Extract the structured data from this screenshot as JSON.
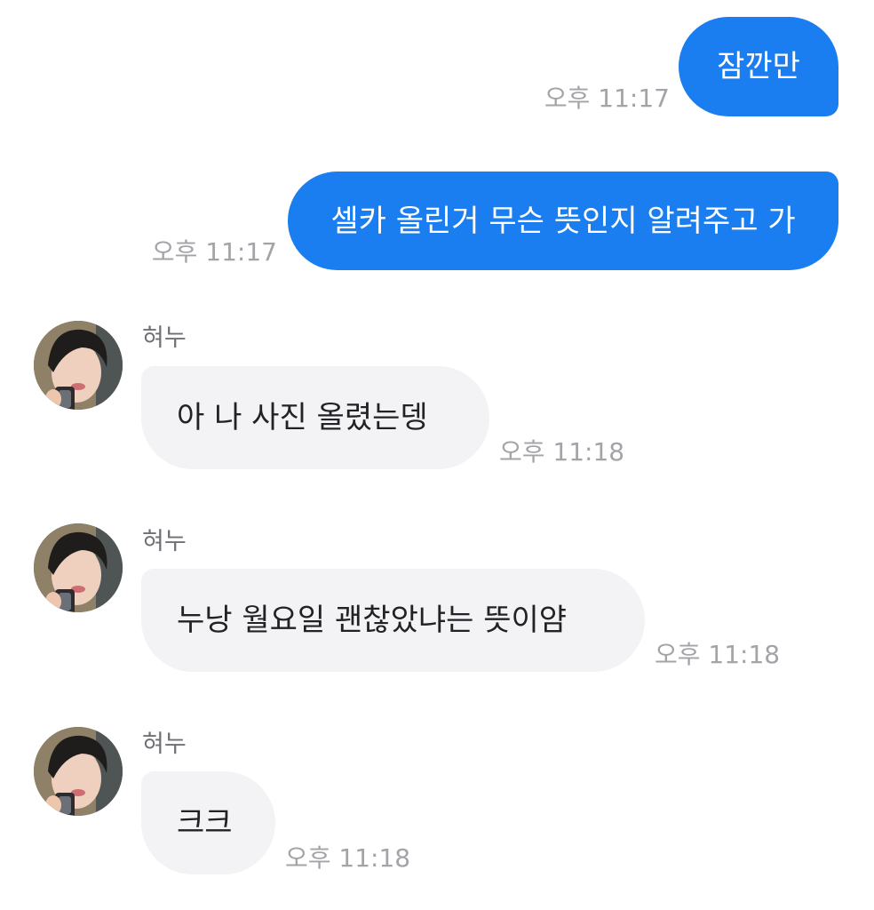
{
  "colors": {
    "sent_bubble": "#1a7ef0",
    "received_bubble": "#f3f3f6",
    "timestamp": "#a3a3a8",
    "sender_name": "#6f6f75"
  },
  "messages": [
    {
      "direction": "sent",
      "text": "잠깐만",
      "time": "오후 11:17"
    },
    {
      "direction": "sent",
      "text": "셀카 올린거 무슨 뜻인지 알려주고 가",
      "time": "오후 11:17"
    },
    {
      "direction": "received",
      "sender": "혀누",
      "avatar": "profile-photo",
      "text": "아 나 사진 올렸는뎅",
      "time": "오후 11:18"
    },
    {
      "direction": "received",
      "sender": "혀누",
      "avatar": "profile-photo",
      "text": "누낭 월요일 괜찮았냐는 뜻이얌",
      "time": "오후 11:18"
    },
    {
      "direction": "received",
      "sender": "혀누",
      "avatar": "profile-photo",
      "text": "크크",
      "time": "오후 11:18"
    }
  ]
}
